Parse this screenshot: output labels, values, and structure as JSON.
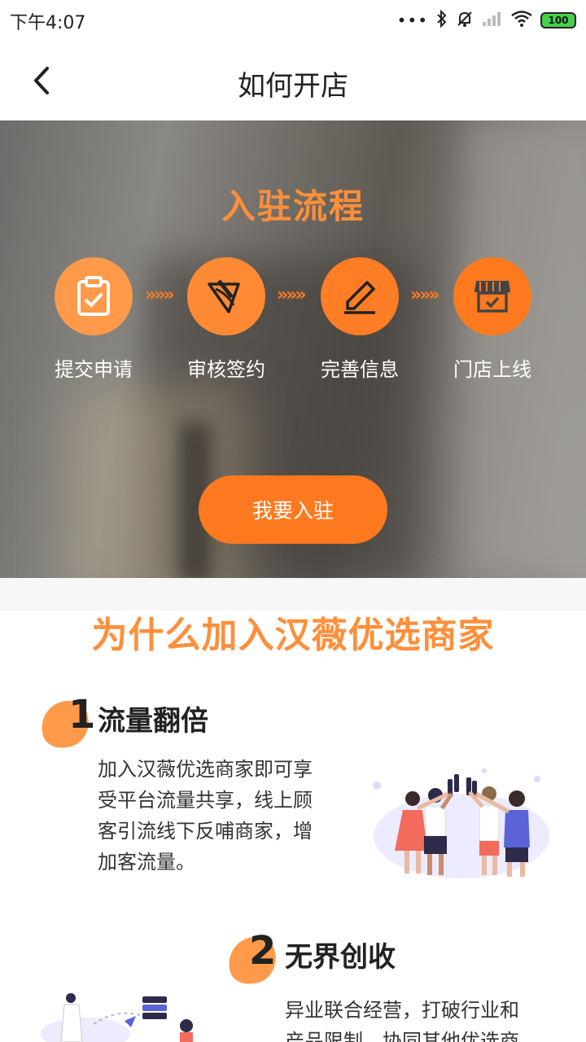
{
  "status_bar": {
    "time": "下午4:07",
    "battery": "100"
  },
  "header": {
    "title": "如何开店"
  },
  "hero": {
    "title": "入驻流程",
    "steps": [
      {
        "label": "提交申请",
        "icon": "clipboard-check-icon"
      },
      {
        "label": "审核签约",
        "icon": "sign-pen-icon"
      },
      {
        "label": "完善信息",
        "icon": "edit-pencil-icon"
      },
      {
        "label": "门店上线",
        "icon": "storefront-icon"
      }
    ],
    "arrow": "»»»",
    "join_button": "我要入驻"
  },
  "why": {
    "title": "为什么加入汉薇优选商家",
    "features": [
      {
        "number": "1",
        "title": "流量翻倍",
        "lines": [
          "加入汉薇优选商家即可享",
          "受平台流量共享，线上顾",
          "客引流线下反哺商家，增",
          "加客流量。"
        ]
      },
      {
        "number": "2",
        "title": "无界创收",
        "lines": [
          "异业联合经营，打破行业和",
          "产品限制，协同其他优选商"
        ]
      }
    ]
  },
  "colors": {
    "accent": "#ff7a1f",
    "accent_light": "#ff9a4a",
    "title_orange": "#ff8f3a"
  }
}
